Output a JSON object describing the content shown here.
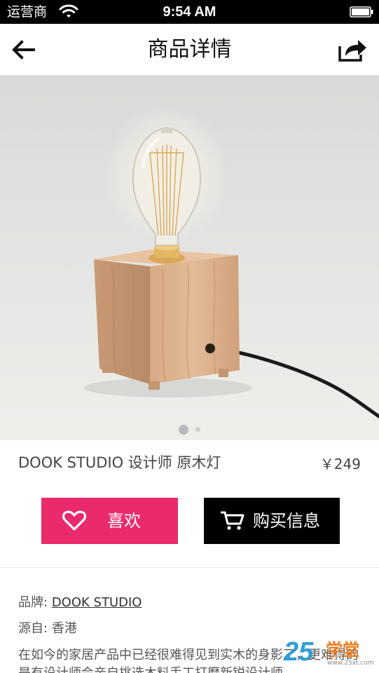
{
  "status_bar": {
    "carrier": "运营商",
    "time": "9:54 AM"
  },
  "nav": {
    "title": "商品详情",
    "back_icon": "back-arrow-icon",
    "share_icon": "share-icon"
  },
  "gallery": {
    "total_pages": 2,
    "current_page": 1
  },
  "product": {
    "name": "DOOK STUDIO 设计师 原木灯",
    "price": "￥249"
  },
  "actions": {
    "like_label": "喜欢",
    "buy_label": "购买信息",
    "like_color": "#ea2a6c",
    "buy_color": "#000000"
  },
  "details": {
    "brand_label": "品牌:",
    "brand_value": "DOOK STUDIO",
    "origin_label": "源自:",
    "origin_value": "香港",
    "description": "在如今的家居产品中已经很难得见到实木的身影了，更难得的是有设计师会亲自挑选木料手工打磨新锐设计师"
  },
  "watermark": {
    "number": "25",
    "text": "学堂",
    "url": "www.25xt.com"
  }
}
